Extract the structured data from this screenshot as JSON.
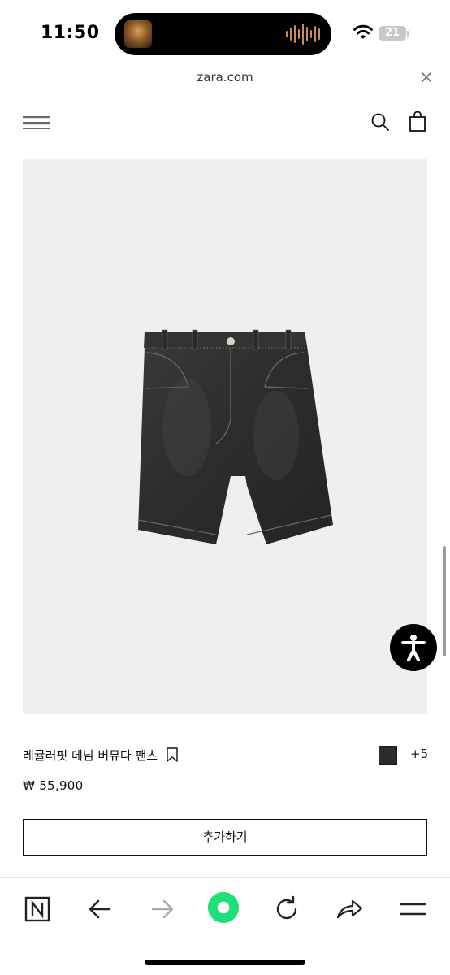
{
  "status_bar": {
    "time": "11:50",
    "battery": "21",
    "icons": [
      "now-playing-album-icon",
      "audio-waveform-icon",
      "wifi-icon",
      "battery-icon"
    ]
  },
  "address_bar": {
    "url": "zara.com",
    "close_icon": "close-icon"
  },
  "header": {
    "icons": [
      "menu-icon",
      "search-icon",
      "shopping-bag-icon"
    ]
  },
  "product": {
    "name": "레귤러핏 데님 버뮤다 팬츠",
    "price": "₩ 55,900",
    "more_colors": "+5",
    "swatch_color": "#2b2b2b",
    "add_label": "추가하기",
    "image_subject": "black washed denim bermuda shorts"
  },
  "toolbar": {
    "icons": [
      "naver-home-icon",
      "back-arrow-icon",
      "forward-arrow-icon",
      "green-dot-icon",
      "reload-icon",
      "share-icon",
      "menu-icon"
    ],
    "accent_color": "#1ee07a"
  },
  "accessibility": {
    "icon": "accessibility-icon"
  }
}
